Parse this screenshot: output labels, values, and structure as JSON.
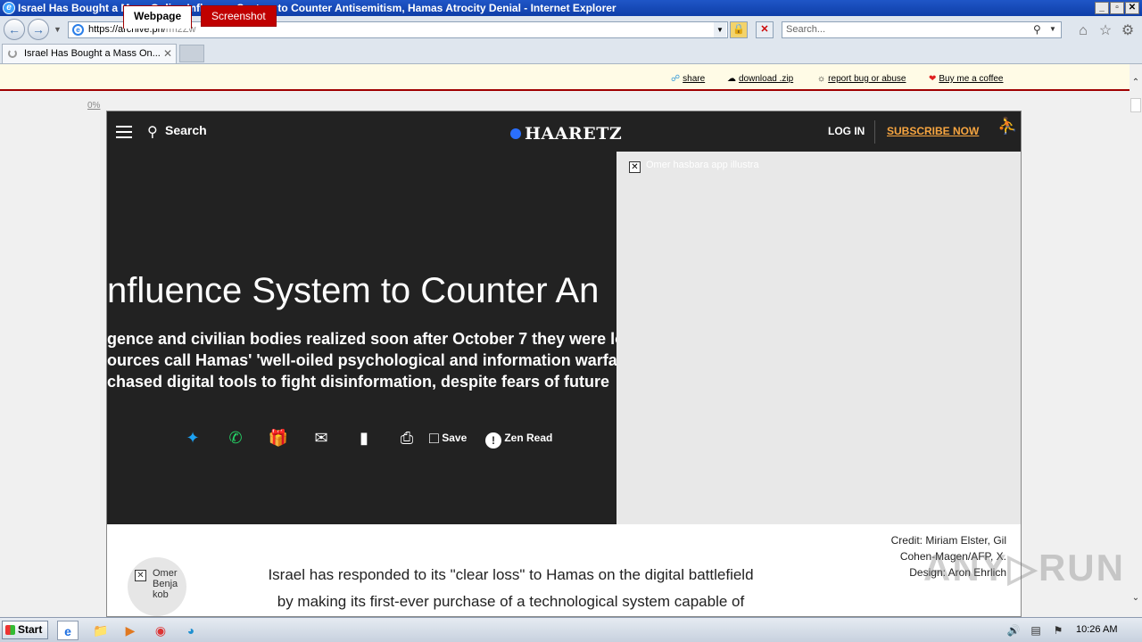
{
  "window": {
    "title": "Israel Has Bought a Mass Online Influence System to Counter Antisemitism, Hamas Atrocity Denial - Internet Explorer",
    "controls": [
      "_",
      "▫",
      "✕"
    ]
  },
  "nav": {
    "back_icon": "back-arrow-icon",
    "forward_icon": "forward-arrow-icon",
    "url_host": "https://archive.ph/",
    "url_path": "rm2Zw",
    "search_placeholder": "Search..."
  },
  "tabs": [
    {
      "label": "Israel Has Bought a Mass On...",
      "loading": true
    }
  ],
  "archive": {
    "tab_webpage": "Webpage",
    "tab_screenshot": "Screenshot",
    "link_share": "share",
    "link_download": "download .zip",
    "link_report": "report bug or abuse",
    "link_coffee": "Buy me a coffee",
    "percent": "0%",
    "accent": "#a00000"
  },
  "haaretz": {
    "search_label": "Search",
    "logo": "HAARETZ",
    "login": "LOG IN",
    "subscribe": "SUBSCRIBE NOW",
    "headline": "nfluence System to Counter An",
    "subhead": [
      "gence and civilian bodies realized soon after October 7 they were lo",
      "ources call Hamas' 'well-oiled psychological and information warfa",
      "chased digital tools to fight disinformation, despite fears of future"
    ],
    "share_save": "Save",
    "share_zen": "Zen Read",
    "image_alt": "Omer hasbara app illustra",
    "credit": [
      "Credit: Miriam Elster, Gil",
      "Cohen-Magen/AFP, X.",
      "Design: Aron Ehrlich"
    ],
    "author": [
      "Omer",
      "Benja",
      "kob"
    ],
    "body": [
      "Israel has responded to its \"clear loss\" to Hamas on the digital battlefield",
      "by making its first-ever purchase of a technological system capable of"
    ],
    "subscribe_color": "#f7a540",
    "header_bg": "#222222"
  },
  "taskbar": {
    "start": "Start",
    "time": "10:26 AM"
  }
}
